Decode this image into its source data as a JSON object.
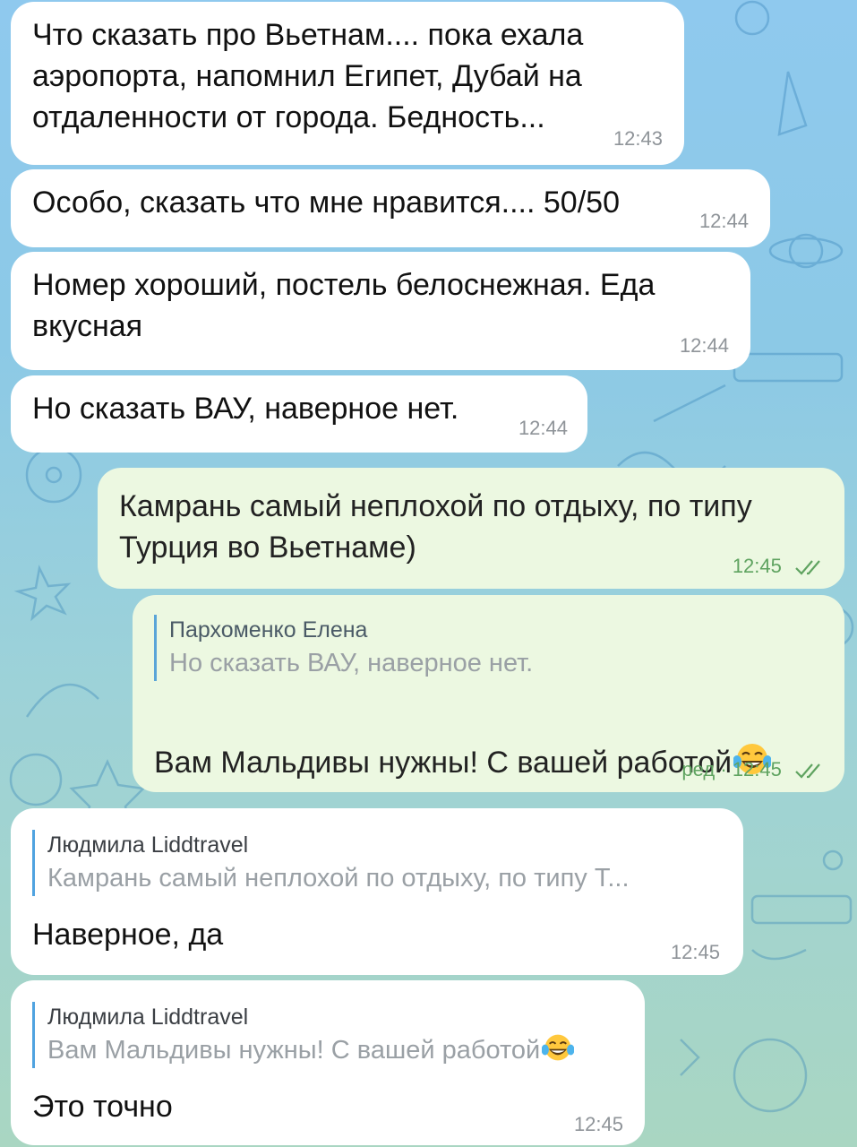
{
  "theme": {
    "incoming_bubble": "#ffffff",
    "outgoing_bubble": "#ecf8e1",
    "time_in": "#8f9499",
    "time_out": "#5fa360",
    "reply_bar": "#4fa3e0"
  },
  "messages": [
    {
      "direction": "in",
      "text": "Что сказать про Вьетнам.... пока ехала\nаэропорта, напомнил Египет, Дубай на\nотдаленности от города. Бедность...",
      "time": "12:43"
    },
    {
      "direction": "in",
      "text": "Особо, сказать что мне нравится.... 50/50",
      "time": "12:44"
    },
    {
      "direction": "in",
      "text": "Номер хороший,  постель белоснежная. Еда\nвкусная",
      "time": "12:44"
    },
    {
      "direction": "in",
      "text": "Но сказать ВАУ, наверное нет.",
      "time": "12:44"
    },
    {
      "direction": "out",
      "text": "Камрань самый неплохой по отдыху, по типу\nТурция во Вьетнаме)",
      "time": "12:45",
      "status_icon": "double-check-icon"
    },
    {
      "direction": "out",
      "reply_author": "Пархоменко Елена",
      "reply_text": "Но сказать ВАУ, наверное нет.",
      "text": "Вам Мальдивы нужны! С вашей работой",
      "emoji": "laughing-tears-emoji",
      "edited_label": "ред",
      "time": "12:45",
      "status_icon": "double-check-icon"
    },
    {
      "direction": "in",
      "reply_author": "Людмила Liddtravel",
      "reply_text": "Камрань самый неплохой по отдыху, по типу Т...",
      "text": "Наверное, да",
      "time": "12:45"
    },
    {
      "direction": "in",
      "reply_author": "Людмила Liddtravel",
      "reply_text": "Вам Мальдивы нужны! С вашей работой",
      "reply_emoji": "laughing-tears-emoji",
      "text": "Это точно",
      "time": "12:45"
    }
  ]
}
